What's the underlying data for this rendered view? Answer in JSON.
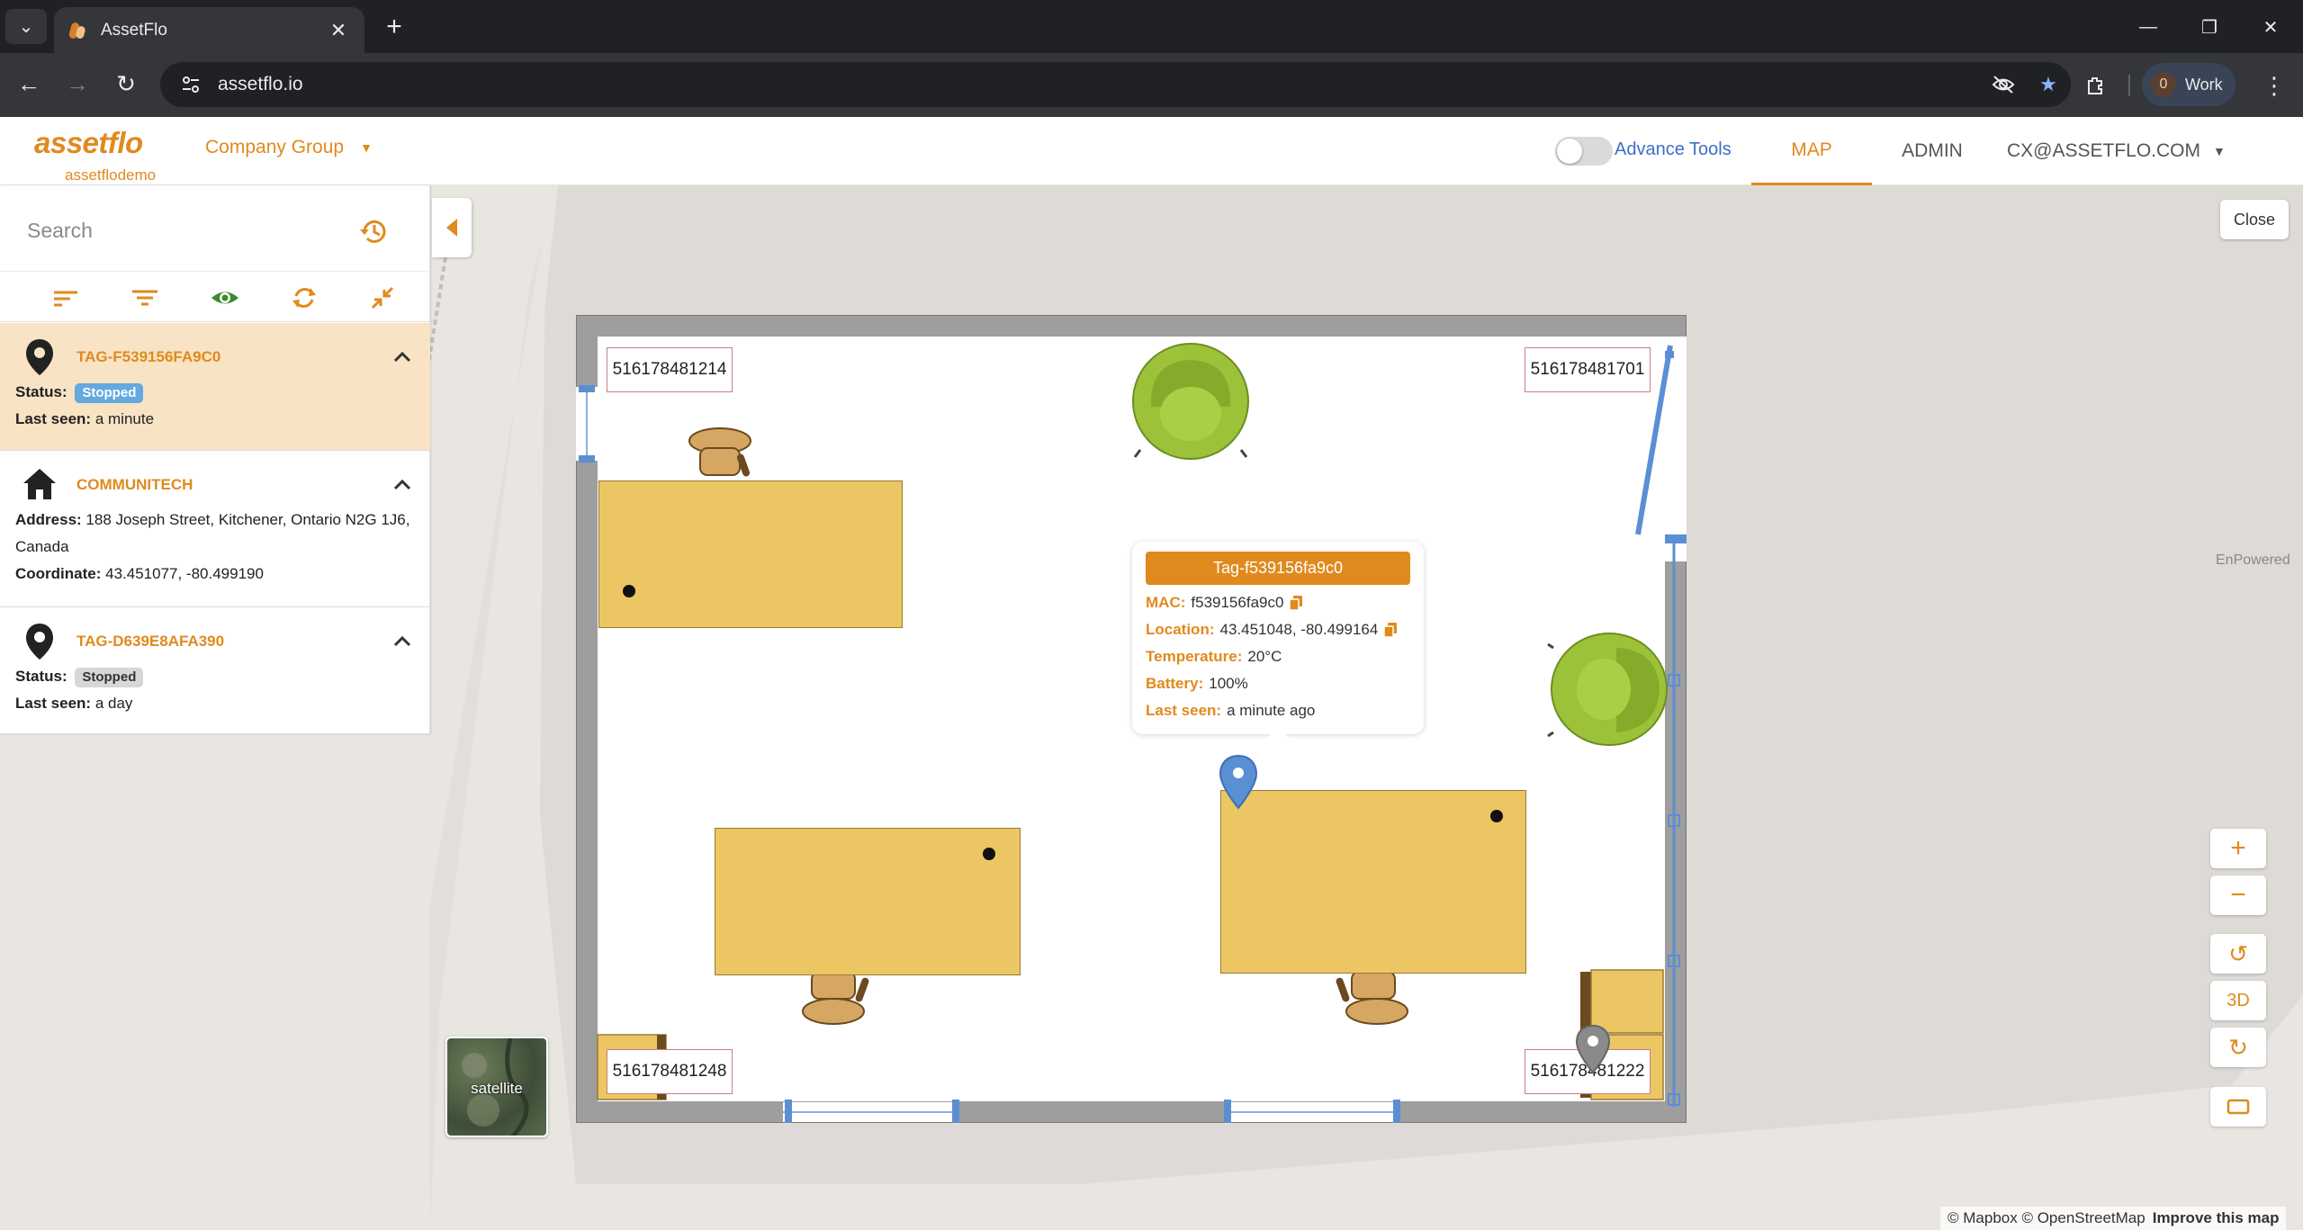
{
  "browser": {
    "tab_title": "AssetFlo",
    "url": "assetflo.io",
    "profile_count": "0",
    "profile_label": "Work"
  },
  "header": {
    "logo": "assetflo",
    "logo_sub": "assetflodemo",
    "company_group": "Company Group",
    "advance_tools": "Advance Tools",
    "nav_map": "MAP",
    "nav_admin": "ADMIN",
    "user": "CX@ASSETFLO.COM"
  },
  "sidebar": {
    "search_placeholder": "Search",
    "items": [
      {
        "title": "TAG-F539156FA9C0",
        "status_label": "Status:",
        "status": "Stopped",
        "last_seen_label": "Last seen:",
        "last_seen": "a minute"
      },
      {
        "title": "COMMUNITECH",
        "address_label": "Address:",
        "address": "188 Joseph Street, Kitchener, Ontario N2G 1J6, Canada",
        "coordinate_label": "Coordinate:",
        "coordinate": "43.451077, -80.499190"
      },
      {
        "title": "TAG-D639E8AFA390",
        "status_label": "Status:",
        "status": "Stopped",
        "last_seen_label": "Last seen:",
        "last_seen": "a day"
      }
    ]
  },
  "map": {
    "close": "Close",
    "watermark": "EnPowered",
    "labels": [
      "516178481214",
      "516178481701",
      "516178481248",
      "516178481222"
    ],
    "satellite": "satellite",
    "controls": {
      "three_d": "3D"
    },
    "attribution": "© Mapbox © OpenStreetMap",
    "improve": "Improve this map",
    "colors": {
      "accent": "#e08a1e",
      "desk": "#ecc662",
      "pin": "#5b8fd4",
      "chair_green": "#9cc23a"
    }
  },
  "popup": {
    "title": "Tag-f539156fa9c0",
    "mac_label": "MAC:",
    "mac": "f539156fa9c0",
    "location_label": "Location:",
    "location": "43.451048, -80.499164",
    "temperature_label": "Temperature:",
    "temperature": "20°C",
    "battery_label": "Battery:",
    "battery": "100%",
    "last_seen_label": "Last seen:",
    "last_seen": "a minute ago"
  }
}
